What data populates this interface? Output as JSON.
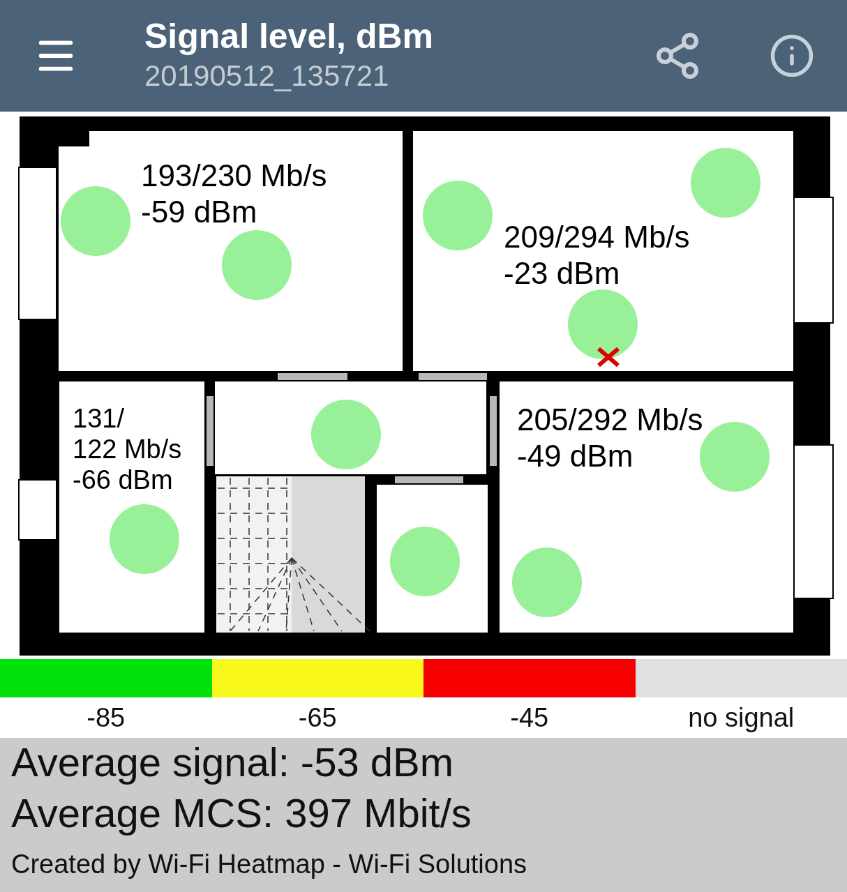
{
  "header": {
    "title": "Signal level, dBm",
    "subtitle": "20190512_135721"
  },
  "rooms": [
    {
      "speed": "193/230 Mb/s",
      "signal": "-59 dBm"
    },
    {
      "speed": "209/294 Mb/s",
      "signal": "-23 dBm"
    },
    {
      "speed": "131/\n122 Mb/s",
      "signal": "-66 dBm"
    },
    {
      "speed": "205/292 Mb/s",
      "signal": "-49 dBm"
    }
  ],
  "legend": [
    {
      "label": "-85",
      "color": "#00e10c"
    },
    {
      "label": "-65",
      "color": "#f8f81a"
    },
    {
      "label": "-45",
      "color": "#f80000"
    },
    {
      "label": "no signal",
      "color": "#e0e0e0"
    }
  ],
  "stats": {
    "average_signal": "Average signal: -53 dBm",
    "average_mcs": "Average MCS: 397 Mbit/s",
    "credit": "Created by Wi-Fi Heatmap - Wi-Fi Solutions"
  }
}
